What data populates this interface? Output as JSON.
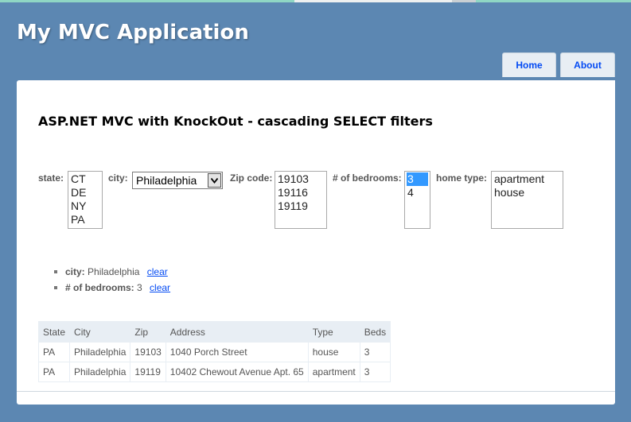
{
  "app": {
    "title": "My MVC Application"
  },
  "menu": {
    "home": "Home",
    "about": "About"
  },
  "page": {
    "title": "ASP.NET MVC with KnockOut - cascading SELECT filters"
  },
  "filters": {
    "state": {
      "label": "state:",
      "options": [
        "CT",
        "DE",
        "NY",
        "PA"
      ]
    },
    "city": {
      "label": "city:",
      "selected": "Philadelphia"
    },
    "zip": {
      "label": "Zip code:",
      "options": [
        "19103",
        "19116",
        "19119"
      ]
    },
    "bedrooms": {
      "label": "# of bedrooms:",
      "options": [
        "3",
        "4"
      ],
      "selected": "3"
    },
    "home_type": {
      "label": "home type:",
      "options": [
        "apartment",
        "house"
      ]
    }
  },
  "active_filters": [
    {
      "name": "city:",
      "value": "Philadelphia",
      "clear": "clear"
    },
    {
      "name": "# of bedrooms:",
      "value": "3",
      "clear": "clear"
    }
  ],
  "table": {
    "headers": [
      "State",
      "City",
      "Zip",
      "Address",
      "Type",
      "Beds"
    ],
    "rows": [
      [
        "PA",
        "Philadelphia",
        "19103",
        "1040 Porch Street",
        "house",
        "3"
      ],
      [
        "PA",
        "Philadelphia",
        "19119",
        "10402 Chewout Avenue Apt. 65",
        "apartment",
        "3"
      ]
    ]
  },
  "colors": {
    "background": "#5c87b2",
    "link": "#034af3",
    "selection": "#3399ff",
    "table_header": "#e8eef4"
  },
  "icons": {
    "dropdown": "chevron-down-icon",
    "bullet": "bullet-icon"
  }
}
